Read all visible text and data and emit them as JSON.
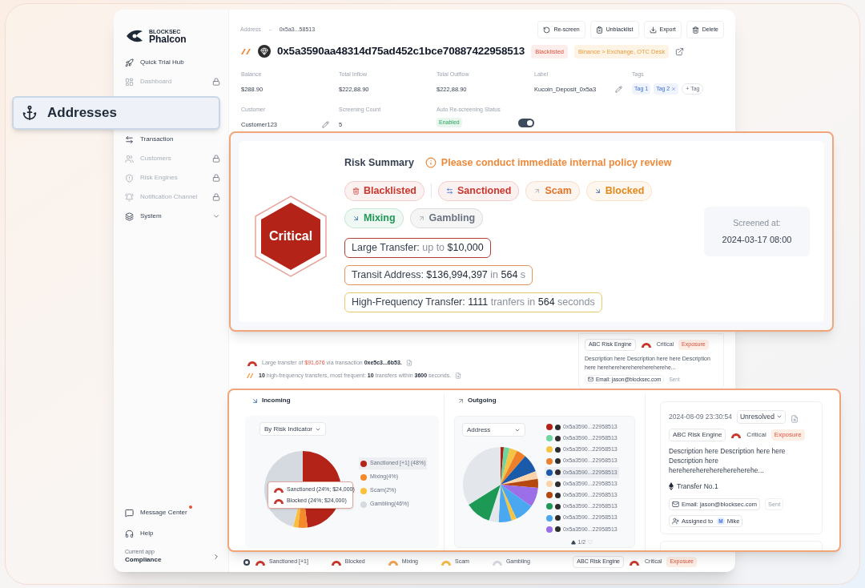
{
  "sidebar": {
    "brand_small": "BLOCKSEC",
    "brand": "Phalcon",
    "items": [
      {
        "label": "Quick Trial Hub",
        "kind": "link",
        "locked": false,
        "selected": false
      },
      {
        "label": "Dashboard",
        "kind": "link",
        "locked": true,
        "selected": false
      },
      {
        "label": "Addresses",
        "kind": "link",
        "locked": false,
        "selected": true
      },
      {
        "label": "Transaction",
        "kind": "link",
        "locked": false,
        "selected": false
      },
      {
        "label": "Customers",
        "kind": "link",
        "locked": true,
        "selected": false
      },
      {
        "label": "Risk Engines",
        "kind": "link",
        "locked": true,
        "selected": false
      },
      {
        "label": "Notification Channel",
        "kind": "link",
        "locked": true,
        "selected": false
      },
      {
        "label": "System",
        "kind": "group",
        "locked": false,
        "selected": false
      }
    ],
    "footer": [
      {
        "label": "Message Center",
        "unread": true
      },
      {
        "label": "Help",
        "unread": false
      }
    ],
    "current_app": {
      "caption": "Current app",
      "name": "Compliance"
    }
  },
  "header": {
    "breadcrumb": [
      "Address",
      "0x5a3...58513"
    ],
    "actions": [
      "Re-screen",
      "Unblacklist",
      "Export",
      "Delete"
    ],
    "address": "0x5a3590aa48314d75ad452c1bce70887422958513",
    "badges": [
      {
        "label": "Blacklisted",
        "kind": "danger"
      },
      {
        "label": "Binance > Exchange, OTC Desk",
        "kind": "warning"
      }
    ],
    "fields": [
      {
        "label": "Balance",
        "value": "$288.90"
      },
      {
        "label": "Total Inflow",
        "value": "$222,88.90"
      },
      {
        "label": "Total Outflow",
        "value": "$222,88.90"
      },
      {
        "label": "Label",
        "value": "Kucoin_Deposit_0x5a3",
        "editable": true
      }
    ],
    "tags_label": "Tags",
    "tags": [
      {
        "label": "Tag 1",
        "removable": false
      },
      {
        "label": "Tag 2",
        "removable": true
      }
    ],
    "add_tag": "+ Tag",
    "customer": {
      "label": "Customer",
      "value": "Customer123",
      "editable": true
    },
    "screening_count": {
      "label": "Screening Count",
      "value": "5"
    },
    "auto_rescreening": {
      "label": "Auto Re-screening Status",
      "status": "Enabled",
      "on": true
    }
  },
  "risk_summary": {
    "level": "Critical",
    "title": "Risk Summary",
    "warning": "Please conduct immediate internal policy review",
    "tags": [
      {
        "label": "Blacklisted",
        "kind": "bin",
        "color": "#c8372d"
      },
      {
        "label": "Sanctioned",
        "kind": "swap",
        "color": "#c8372d"
      },
      {
        "label": "Scam",
        "kind": "up",
        "color": "#e0762b"
      },
      {
        "label": "Blocked",
        "kind": "down",
        "color": "#e08a1e"
      },
      {
        "label": "Mixing",
        "kind": "down",
        "color": "#1e9a55"
      },
      {
        "label": "Gambling",
        "kind": "up",
        "color": "#6b7280"
      }
    ],
    "details": [
      {
        "color": "#b0403a",
        "segments": [
          {
            "text": "Large Transfer: ",
            "kind": "label"
          },
          {
            "text": "up to ",
            "kind": "muted"
          },
          {
            "text": "$10,000",
            "kind": "value"
          }
        ]
      },
      {
        "color": "#e4935a",
        "segments": [
          {
            "text": "Transit Address: ",
            "kind": "label"
          },
          {
            "text": "$136,994,397",
            "kind": "value"
          },
          {
            "text": " in ",
            "kind": "muted"
          },
          {
            "text": "564",
            "kind": "value"
          },
          {
            "text": " s",
            "kind": "muted"
          }
        ]
      },
      {
        "color": "#eccb6a",
        "segments": [
          {
            "text": "High-Frequency Transfer: ",
            "kind": "label"
          },
          {
            "text": "1111",
            "kind": "value"
          },
          {
            "text": " tranfers in ",
            "kind": "muted"
          },
          {
            "text": "564",
            "kind": "value"
          },
          {
            "text": " seconds",
            "kind": "muted"
          }
        ]
      }
    ],
    "screened_label": "Screened at:",
    "screened_at": "2024-03-17 08:00"
  },
  "findings": [
    {
      "color": "#c8372d",
      "segments": [
        {
          "text": "Large transfer of ",
          "kind": "muted"
        },
        {
          "text": "$91,676",
          "kind": "accent"
        },
        {
          "text": " via transaction ",
          "kind": "muted"
        },
        {
          "text": "0xe5c3...6b53.",
          "kind": "value"
        }
      ]
    },
    {
      "color": "#f0a050",
      "segments": [
        {
          "text": "10",
          "kind": "value"
        },
        {
          "text": " high-frequency transfers, most frequent: ",
          "kind": "muted"
        },
        {
          "text": "10",
          "kind": "value"
        },
        {
          "text": " transfers within ",
          "kind": "muted"
        },
        {
          "text": "3600",
          "kind": "value"
        },
        {
          "text": " seconds.",
          "kind": "muted"
        }
      ]
    }
  ],
  "side_alert": {
    "engine": "ABC Risk Engine",
    "severity": "Critical",
    "type": "Exposure",
    "description": "Description here Description here here Description here hereherehereherehereherehe...",
    "email": "Email: jason@blocksec.com",
    "email_status": "Sent"
  },
  "incoming": {
    "title": "Incoming",
    "selector": "By Risk Indicator",
    "chart_data": {
      "type": "pie",
      "values": [
        48,
        4,
        2,
        46
      ]
    },
    "legend": [
      {
        "label": "Sanctioned [+1] (48%)",
        "color": "#b42318",
        "selected": true
      },
      {
        "label": "Mixing(4%)",
        "color": "#f58a2c",
        "selected": false
      },
      {
        "label": "Scam(2%)",
        "color": "#fbbf3b",
        "selected": false
      },
      {
        "label": "Gambling(46%)",
        "color": "#d5d9e0",
        "selected": false
      }
    ],
    "tooltip": [
      "Sanctioned (24%; $24,000)",
      "Blocked (24%; $24,000)"
    ]
  },
  "outgoing": {
    "title": "Outgoing",
    "selector": "Address",
    "addresses": [
      {
        "label": "0x5a3590...22958513",
        "color": "#b42318",
        "selected": false
      },
      {
        "label": "0x5a3590...22958513",
        "color": "#6fd6a0",
        "selected": false
      },
      {
        "label": "0x5a3590...22958513",
        "color": "#f6c445",
        "selected": false
      },
      {
        "label": "0x5a3590...22958513",
        "color": "#f07f2a",
        "selected": false
      },
      {
        "label": "0x5a3590...22958513",
        "color": "#1a5aa8",
        "selected": true
      },
      {
        "label": "0x5a3590...22958513",
        "color": "#fbd3a8",
        "selected": false
      },
      {
        "label": "0x5a3590...22958513",
        "color": "#b5480f",
        "selected": false
      },
      {
        "label": "0x5a3590...22958513",
        "color": "#1c9a55",
        "selected": false
      },
      {
        "label": "0x5a3590...22958513",
        "color": "#4aa8f0",
        "selected": false
      },
      {
        "label": "0x5a3590...22958513",
        "color": "#9b6fe8",
        "selected": false
      }
    ],
    "pager": "1/2"
  },
  "alert_card": {
    "time": "2024-08-09 23:30:54",
    "status": "Unresolved",
    "engine": "ABC Risk Engine",
    "severity": "Critical",
    "type": "Exposure",
    "description": "Description here Description here here Description here hereherehereherehereherehe...",
    "transfer": "Transfer No.1",
    "email": "Email: jason@blocksec.com",
    "email_status": "Sent",
    "assigned_label": "Assigned to",
    "assignee_initial": "M",
    "assignee": "Mike"
  },
  "bottom_legend": [
    {
      "label": "Sanctioned [+1]",
      "color": "#c8372d"
    },
    {
      "label": "Blocked",
      "color": "#c8372d"
    },
    {
      "label": "Mixing",
      "color": "#f0a050"
    },
    {
      "label": "Scam",
      "color": "#f5b942"
    },
    {
      "label": "Gambling",
      "color": "#d5d9e0"
    }
  ],
  "bottom_alert": {
    "engine": "ABC Risk Engine",
    "severity": "Critical",
    "type": "Exposure"
  }
}
